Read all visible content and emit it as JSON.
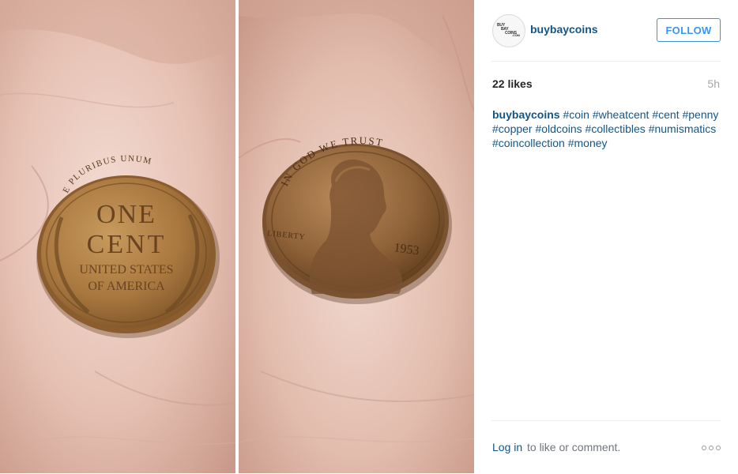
{
  "post": {
    "image_alt": "Two photos of a 1953 wheat cent on a palm: reverse side and obverse side",
    "reverse_coin": {
      "top_text": "E PLURIBUS UNUM",
      "line1": "ONE",
      "line2": "CENT",
      "line3": "UNITED STATES",
      "line4": "OF AMERICA"
    },
    "obverse_coin": {
      "motto": "IN GOD WE TRUST",
      "liberty": "LIBERTY",
      "year": "1953"
    }
  },
  "header": {
    "avatar_text": [
      "BUY",
      "BAY",
      "COINS",
      ".COM"
    ],
    "username": "buybaycoins",
    "follow_label": "FOLLOW"
  },
  "stats": {
    "likes": "22 likes",
    "time": "5h"
  },
  "caption": {
    "username": "buybaycoins",
    "tags": [
      "#coin",
      "#wheatcent",
      "#cent",
      "#penny",
      "#copper",
      "#oldcoins",
      "#collectibles",
      "#numismatics",
      "#coincollection",
      "#money"
    ]
  },
  "footer": {
    "login_link": "Log in",
    "login_rest": "to like or comment.",
    "more_icon": "ellipsis-icon"
  },
  "colors": {
    "link": "#125688",
    "follow_blue": "#3897f0",
    "divider": "#efefef",
    "muted": "#a5a7aa"
  }
}
